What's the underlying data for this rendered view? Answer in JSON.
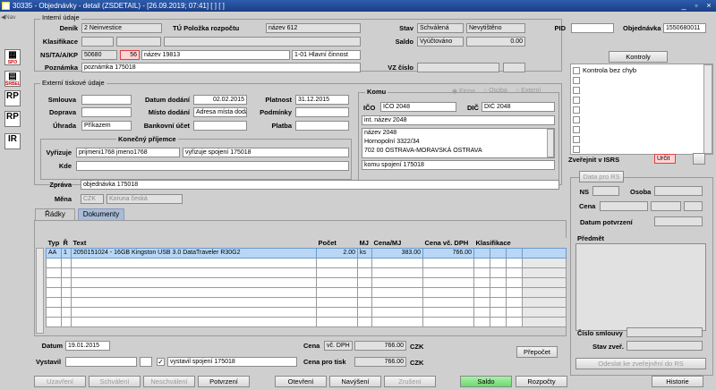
{
  "window": {
    "title": "30335 - Objednávky - detail (ZSDETAIL) - [26.09.2019; 07:41]  [ ]  [ ]",
    "minimize": "_",
    "restore": "▫",
    "close": "×"
  },
  "nav": {
    "label": "Nav",
    "icons": [
      {
        "name": "spo",
        "text": "",
        "sub": "SPO"
      },
      {
        "name": "shelv",
        "text": "",
        "sub": "ŠRBELV"
      },
      {
        "name": "rp1",
        "text": "RP",
        "sub": ""
      },
      {
        "name": "rp2",
        "text": "RP",
        "sub": ""
      },
      {
        "name": "ir",
        "text": "IR",
        "sub": ""
      }
    ]
  },
  "internal": {
    "group_title": "Interní údaje",
    "denik_label": "Deník",
    "denik_value": "2 Neinvestice",
    "tu_label": "TÚ Položka rozpočtu",
    "tu_value": "název 612",
    "klasifikace_label": "Klasifikace",
    "nsta_label": "NS/TA/A/KP",
    "ns_value": "50680",
    "ta_value": "56",
    "nazev_value": "název 19813",
    "kp_value": "1-01 Hlavní činnost",
    "poznamka_label": "Poznámka",
    "poznamka_value": "poznámka 175018",
    "stav_label": "Stav",
    "stav_value1": "Schválená",
    "stav_value2": "Nevytištěno",
    "saldo_label": "Saldo",
    "saldo_value": "Vyúčtováno",
    "saldo_amount": "0.00",
    "vz_label": "VZ číslo",
    "pid_label": "PID",
    "objednavka_label": "Objednávka",
    "objednavka_value": "1550680011"
  },
  "external": {
    "group_title": "Externí tiskové údaje",
    "smlouva_label": "Smlouva",
    "doprava_label": "Doprava",
    "uhrada_label": "Úhrada",
    "uhrada_value": "Příkazem",
    "datum_dodani_label": "Datum dodání",
    "datum_dodani_value": "02.02.2015",
    "misto_dodani_label": "Místo dodání",
    "misto_dodani_value": "Adresa místa dodá",
    "bankovni_label": "Bankovní účet",
    "platnost_label": "Platnost",
    "platnost_value": "31.12.2015",
    "podminky_label": "Podmínky",
    "platba_label": "Platba",
    "konecny_title": "Konečný příjemce",
    "vyrizuje_label": "Vyřizuje",
    "vyrizuje_value1": "prijmeni1768 jmeno1768",
    "vyrizuje_value2": "vyřizuje spojení 175018",
    "kde_label": "Kde",
    "zprava_label": "Zpráva",
    "zprava_value": "objednávka 175018",
    "mena_label": "Měna",
    "mena_code": "CZK",
    "mena_name": "Koruna česká"
  },
  "komu": {
    "title": "Komu",
    "radio_firma": "Firma",
    "radio_osoba": "Osoba",
    "radio_externi": "Externí",
    "ico_label": "IČO",
    "ico_value": "IČO 2048",
    "dic_label": "DIČ",
    "dic_value": "DIČ 2048",
    "int_nazev": "int. název 2048",
    "address": [
      "název 2048",
      "Hornopolní 3322/34",
      "702 00  OSTRAVA-MORAVSKÁ OSTRAVA"
    ],
    "spojeni": "komu spojení 175018"
  },
  "kontroly": {
    "button": "Kontroly",
    "first_item": "Kontrola bez chyb"
  },
  "isrs": {
    "label": "Zveřejnit v ISRS",
    "value": "Určit",
    "data_tab": "Data pro RS",
    "ns_label": "NS",
    "osoba_label": "Osoba",
    "cena_label": "Cena",
    "datum_label": "Datum potvrzení",
    "predmet_label": "Předmět",
    "cislo_label": "Číslo smlouvy",
    "stav_label": "Stav zveř.",
    "odeslat_button": "Odeslat ke zveřejnění do RS"
  },
  "tabs": {
    "radky": "Řádky",
    "dokumenty": "Dokumenty"
  },
  "grid": {
    "headers": [
      "Typ",
      "Ř",
      "Text",
      "Počet",
      "MJ",
      "Cena/MJ",
      "Cena vč. DPH",
      "Klasifikace"
    ],
    "rows": [
      {
        "typ": "AA",
        "r": "1",
        "text": "2050151024 - 16GB Kingston USB 3.0 DataTraveler R30G2",
        "pocet": "2.00",
        "mj": "ks",
        "cena": "383.00",
        "cena_dph": "766.00",
        "klas": ""
      }
    ]
  },
  "footer": {
    "datum_label": "Datum",
    "datum_value": "19.01.2015",
    "vystavil_label": "Vystavil",
    "vystavil_check": "✓",
    "vystavil_spojeni": "vystavil spojení 175018",
    "cena_label": "Cena",
    "cena_dph_tag": "vč. DPH",
    "cena_value": "766.00",
    "cena_currency": "CZK",
    "cena_tisk_label": "Cena pro tisk",
    "cena_tisk_value": "766.00",
    "cena_tisk_currency": "CZK",
    "prepocet": "Přepočet"
  },
  "toolbar": {
    "uzavreni": "Uzavření",
    "schvaleni": "Schválení",
    "neschvaleni": "Neschválení",
    "potvrzeni": "Potvrzení",
    "otevreni": "Otevření",
    "navyseni": "Navýšení",
    "zruseni": "Zrušení",
    "saldo": "Saldo",
    "rozpocty": "Rozpočty",
    "historie": "Historie"
  }
}
